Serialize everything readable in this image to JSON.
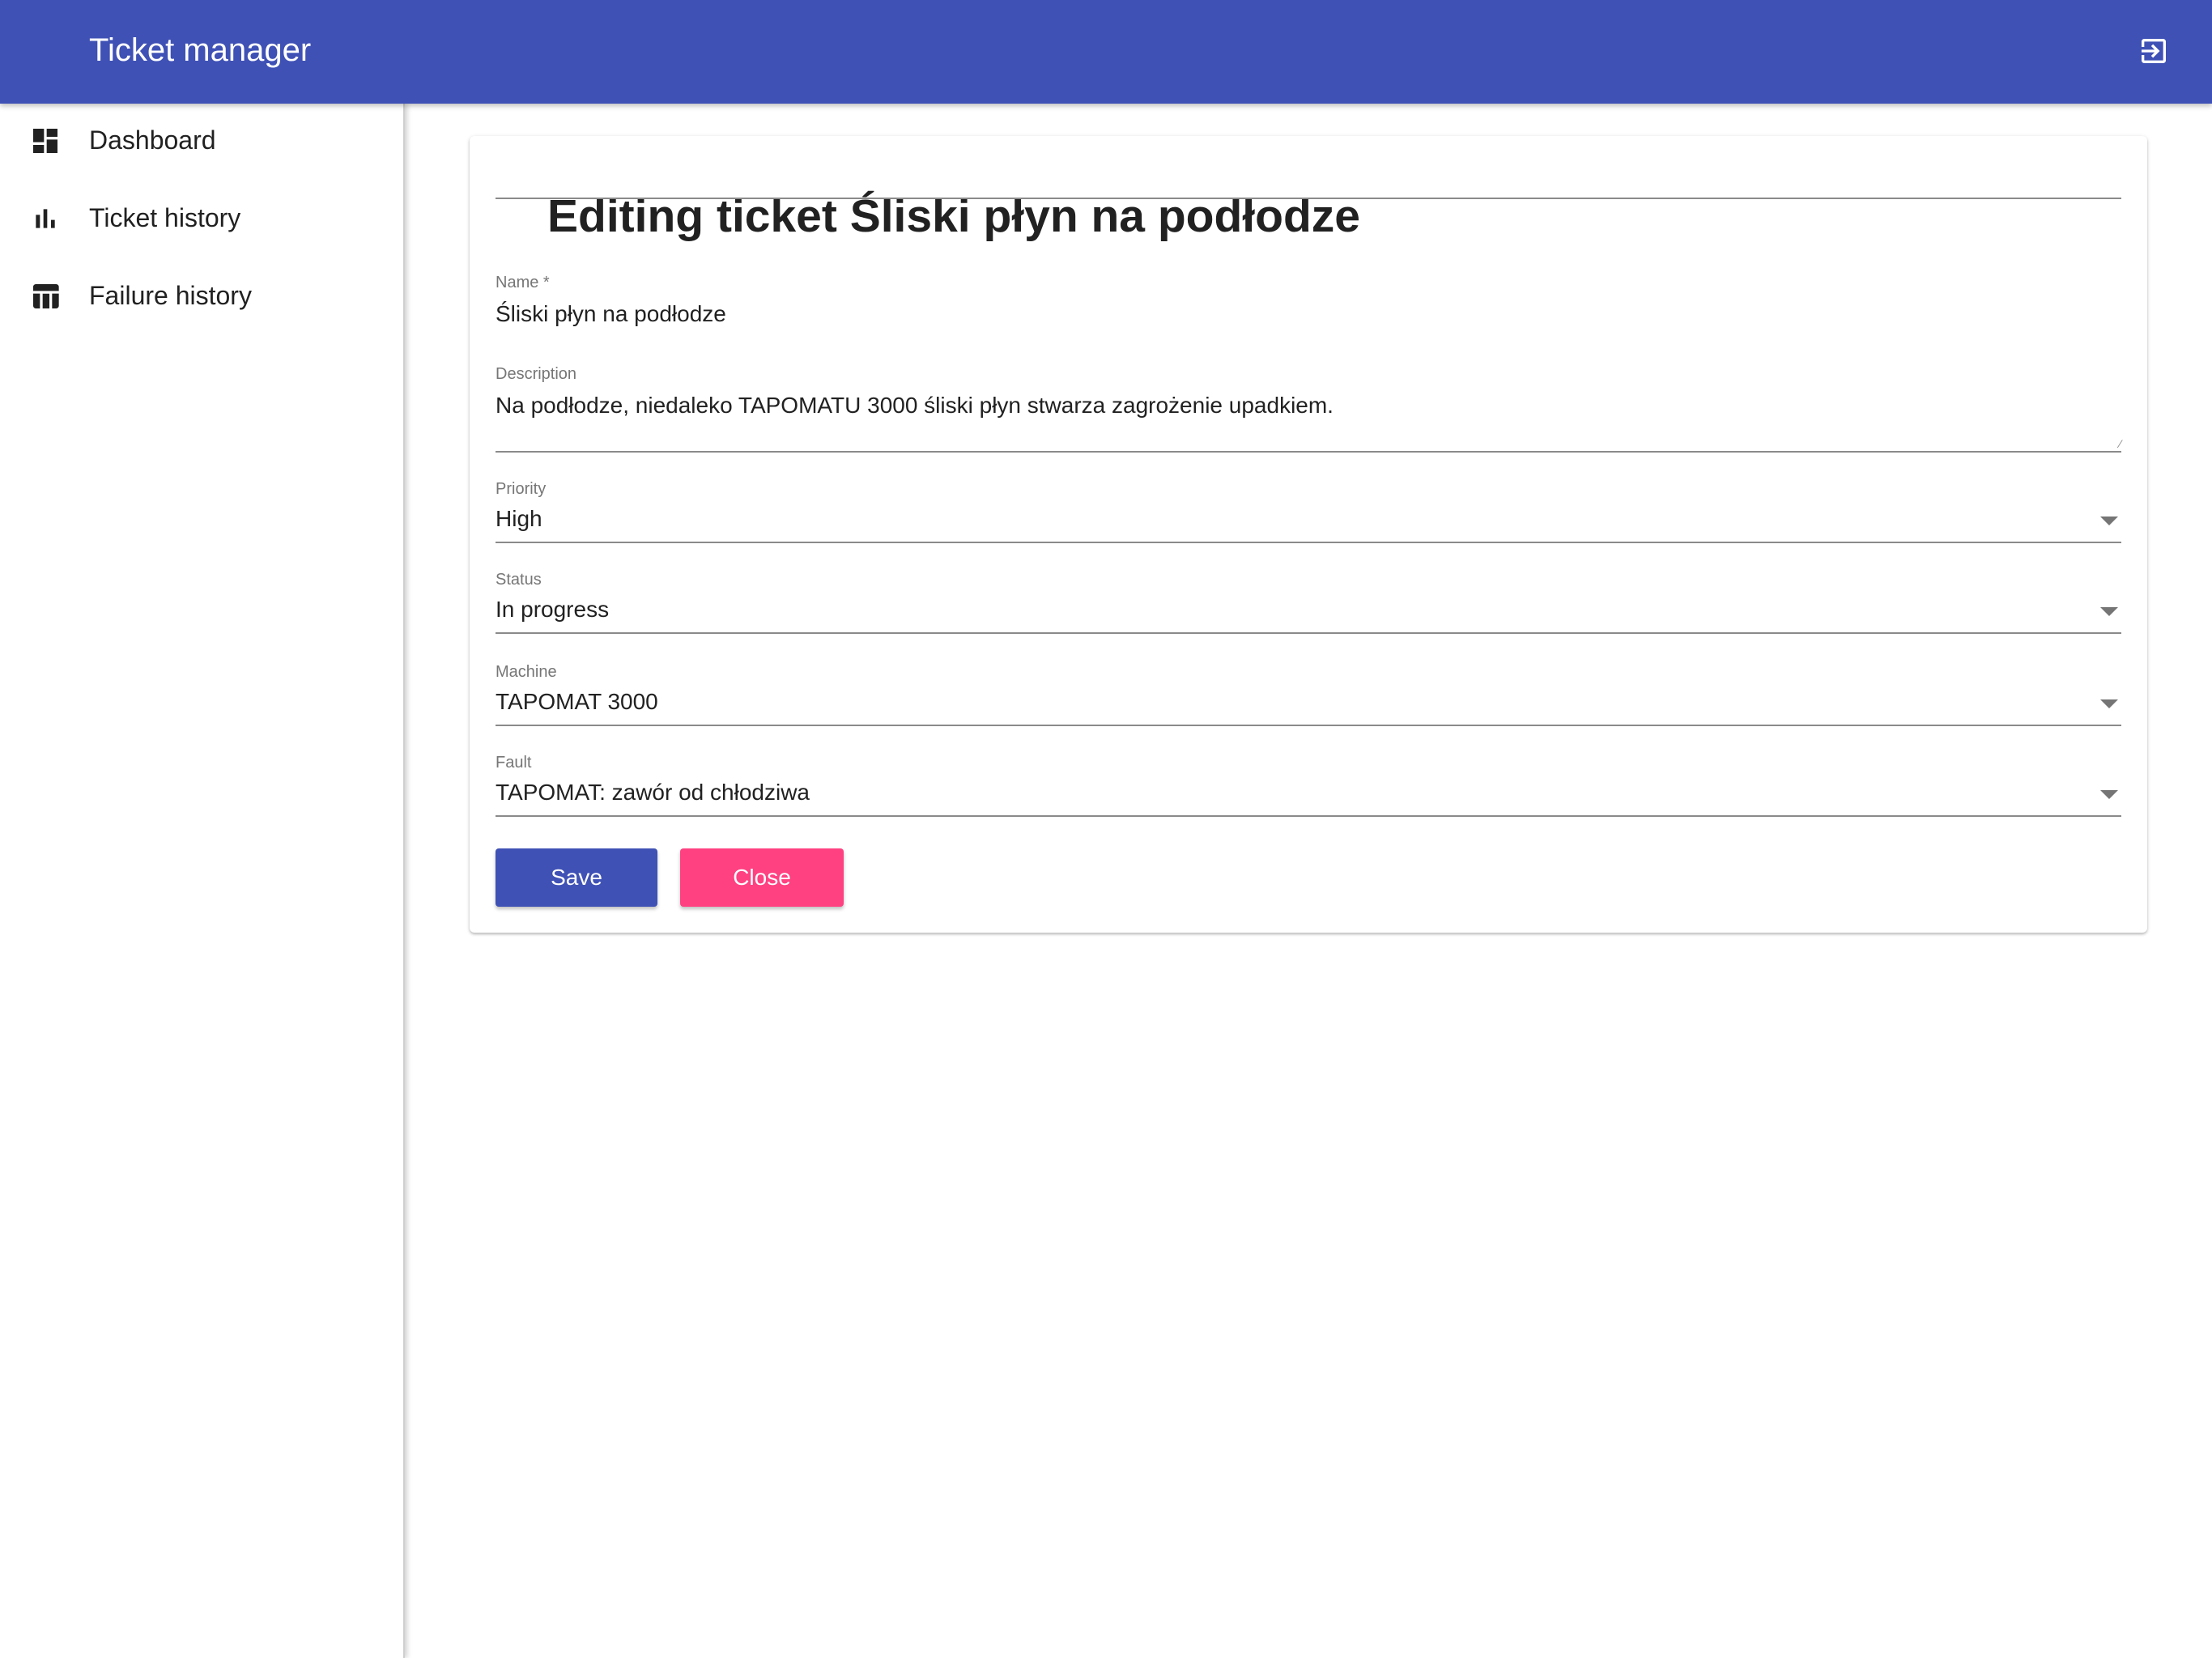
{
  "app": {
    "title": "Ticket manager",
    "header_color": "#3f51b5",
    "logout_icon": "logout-icon"
  },
  "sidebar": {
    "items": [
      {
        "label": "Dashboard",
        "icon": "dashboard-icon"
      },
      {
        "label": "Ticket history",
        "icon": "bar-chart-icon"
      },
      {
        "label": "Failure history",
        "icon": "table-icon"
      }
    ]
  },
  "form": {
    "title": "Editing ticket Śliski płyn na podłodze",
    "fields": {
      "name": {
        "label": "Name *",
        "value": "Śliski płyn na podłodze"
      },
      "description": {
        "label": "Description",
        "value": "Na podłodze, niedaleko TAPOMATU 3000 śliski płyn stwarza zagrożenie upadkiem."
      },
      "priority": {
        "label": "Priority",
        "value": "High"
      },
      "status": {
        "label": "Status",
        "value": "In progress"
      },
      "machine": {
        "label": "Machine",
        "value": "TAPOMAT 3000"
      },
      "fault": {
        "label": "Fault",
        "value": "TAPOMAT: zawór od chłodziwa"
      }
    },
    "buttons": {
      "save": "Save",
      "close": "Close"
    },
    "colors": {
      "primary": "#3f51b5",
      "accent": "#ff4081"
    }
  }
}
